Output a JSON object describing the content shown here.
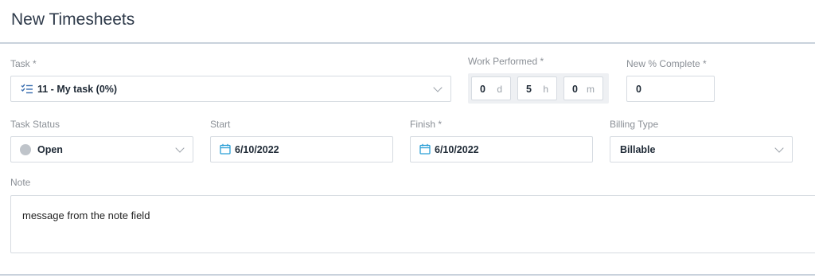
{
  "header": {
    "title": "New Timesheets"
  },
  "task": {
    "label": "Task *",
    "value": "11 - My task (0%)",
    "icon": "task-list-icon"
  },
  "work_performed": {
    "label": "Work Performed *",
    "days": "0",
    "days_unit": "d",
    "hours": "5",
    "hours_unit": "h",
    "minutes": "0",
    "minutes_unit": "m"
  },
  "percent_complete": {
    "label": "New % Complete *",
    "value": "0"
  },
  "task_status": {
    "label": "Task Status",
    "value": "Open",
    "dot_color": "#bfc4ca"
  },
  "start": {
    "label": "Start",
    "value": "6/10/2022",
    "icon": "calendar-icon"
  },
  "finish": {
    "label": "Finish *",
    "value": "6/10/2022",
    "icon": "calendar-icon"
  },
  "billing_type": {
    "label": "Billing Type",
    "value": "Billable"
  },
  "note": {
    "label": "Note",
    "value": "message from the note field"
  },
  "colors": {
    "accent": "#2a9fd6",
    "icon_blue": "#3a6fb0",
    "border": "#d6dbe1"
  }
}
